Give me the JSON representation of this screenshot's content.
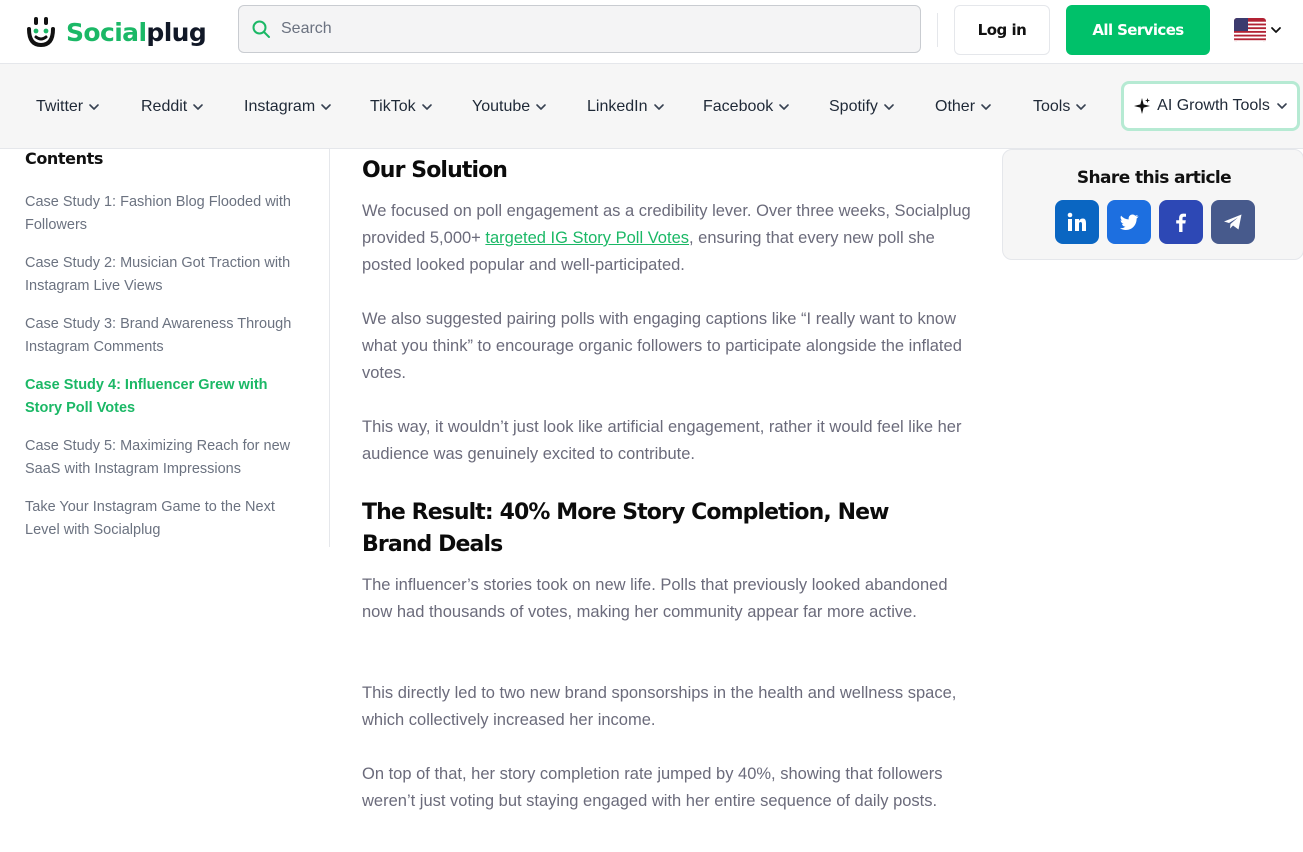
{
  "brand": {
    "name_part1": "Social",
    "name_part2": "plug",
    "accent_color": "#1bb866",
    "icon": "smiley-plug-icon"
  },
  "header": {
    "search_placeholder": "Search",
    "login_label": "Log in",
    "services_label": "All Services",
    "language_icon": "us-flag-icon"
  },
  "nav": {
    "items": [
      {
        "label": "Twitter"
      },
      {
        "label": "Reddit"
      },
      {
        "label": "Instagram"
      },
      {
        "label": "TikTok"
      },
      {
        "label": "Youtube"
      },
      {
        "label": "LinkedIn"
      },
      {
        "label": "Facebook"
      },
      {
        "label": "Spotify"
      },
      {
        "label": "Other"
      },
      {
        "label": "Tools"
      }
    ],
    "ai_tools_label": "AI Growth Tools"
  },
  "toc": {
    "title": "Contents",
    "items": [
      {
        "label": "Case Study 1: Fashion Blog Flooded with Followers"
      },
      {
        "label": "Case Study 2: Musician Got Traction with Instagram Live Views"
      },
      {
        "label": "Case Study 3: Brand Awareness Through Instagram Comments"
      },
      {
        "label": "Case Study 4: Influencer Grew with Story Poll Votes"
      },
      {
        "label": "Case Study 5: Maximizing Reach for new SaaS with Instagram Impressions"
      },
      {
        "label": "Take Your Instagram Game to the Next Level with Socialplug"
      }
    ],
    "active_index": 3
  },
  "article": {
    "solution_heading": "Our Solution",
    "p1_before": "We focused on poll engagement as a credibility lever. Over three weeks, Socialplug provided 5,000+ ",
    "p1_link": "targeted IG Story Poll Votes",
    "p1_after": ", ensuring that every new poll she posted looked popular and well-participated.",
    "p2": "We also suggested pairing polls with engaging captions like “I really want to know what you think” to encourage organic followers to participate alongside the inflated votes.",
    "p3": "This way, it wouldn’t just look like artificial engagement, rather it would feel like her audience was genuinely excited to contribute.",
    "result_heading": "The Result: 40% More Story Completion, New Brand Deals",
    "p4": "The influencer’s stories took on new life. Polls that previously looked abandoned now had thousands of votes, making her community appear far more active.",
    "p5": "This directly led to two new brand sponsorships in the health and wellness space, which collectively increased her income.",
    "p6": "On top of that, her story completion rate jumped by 40%, showing that followers weren’t just voting but staying engaged with her entire sequence of daily posts."
  },
  "share": {
    "title": "Share this article",
    "buttons": [
      {
        "icon": "linkedin-icon",
        "color": "#0a66c2"
      },
      {
        "icon": "twitter-icon",
        "color": "#1d6fe0"
      },
      {
        "icon": "facebook-icon",
        "color": "#2d48b5"
      },
      {
        "icon": "telegram-icon",
        "color": "#475a8c"
      }
    ]
  }
}
